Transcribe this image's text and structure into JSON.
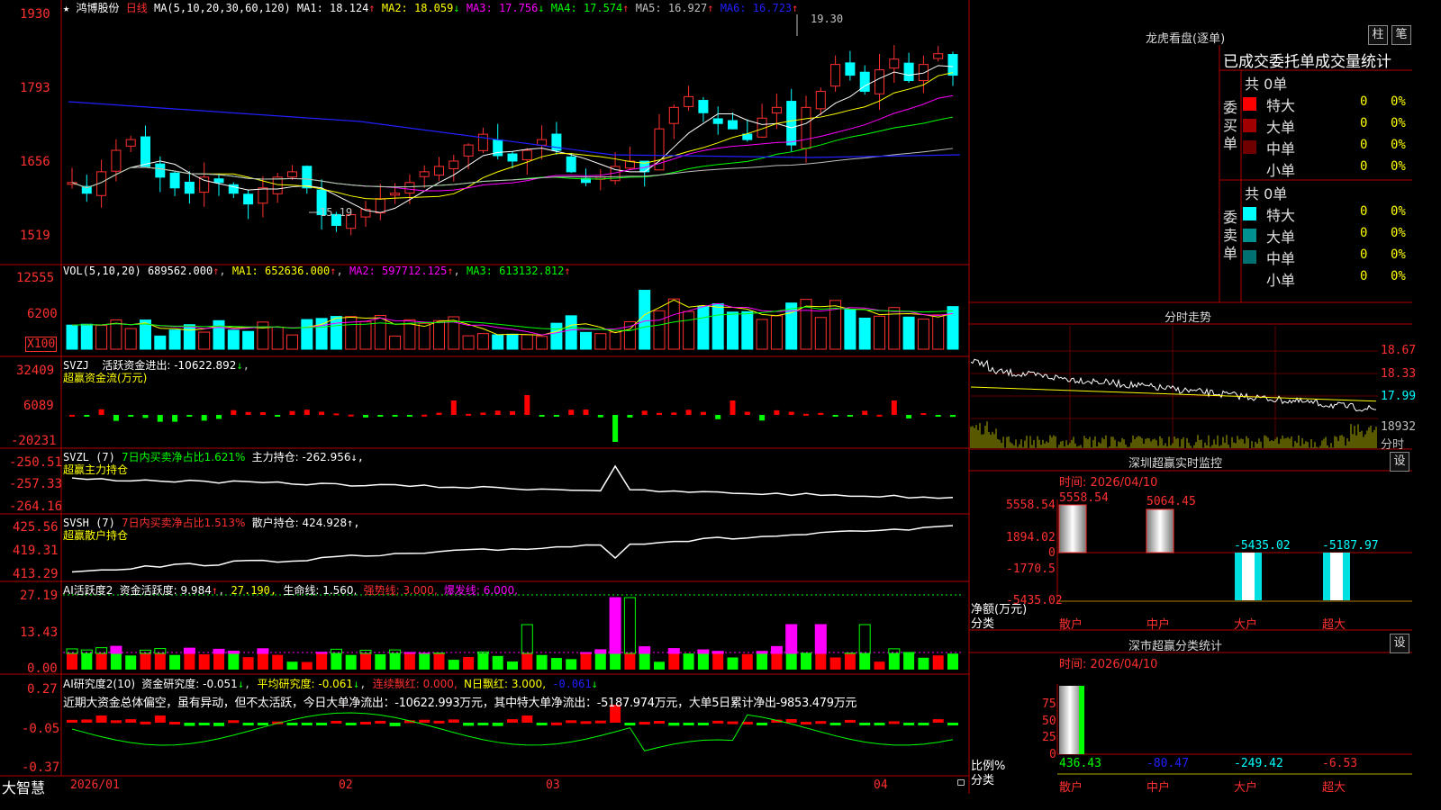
{
  "header": {
    "star": "★",
    "name": "鸿博股份",
    "period": "日线",
    "ma_prefix": "MA(5,10,20,30,60,120)",
    "mas": [
      {
        "label": "MA1: 18.124",
        "arrow": "↑",
        "color": "#ffffff"
      },
      {
        "label": "MA2: 18.059",
        "arrow": "↓",
        "color": "#ffff00"
      },
      {
        "label": "MA3: 17.756",
        "arrow": "↓",
        "color": "#ff00ff"
      },
      {
        "label": "MA4: 17.574",
        "arrow": "↑",
        "color": "#00ff00"
      },
      {
        "label": "MA5: 16.927",
        "arrow": "↑",
        "color": "#c0c0c0"
      },
      {
        "label": "MA6: 16.723",
        "arrow": "↑",
        "color": "#2020ff"
      }
    ]
  },
  "price_axis": [
    "1930",
    "1793",
    "1656",
    "1519"
  ],
  "price_annotations": {
    "high": "19.30",
    "low": "15.19"
  },
  "vol": {
    "title": "VOL(5,10,20)",
    "value": "689562.000",
    "ma1": "MA1: 652636.000",
    "ma2": "MA2: 597712.125",
    "ma3": "MA3: 613132.812",
    "axis": [
      "12555",
      "6200"
    ],
    "multiplier": "X100"
  },
  "svzj": {
    "title": "SVZJ",
    "label": "活跃资金进出: -10622.892",
    "arrow": "↓",
    "subtitle": "超赢资金流(万元)",
    "axis": [
      "32409",
      "6089",
      "-20231"
    ]
  },
  "svzl": {
    "title": "SVZL (7)",
    "label1": "7日内买卖净占比1.621%",
    "label2": "主力持仓: -262.956",
    "arrow": "↓,",
    "subtitle": "超赢主力持仓",
    "axis": [
      "-250.51",
      "-257.33",
      "-264.16"
    ]
  },
  "svsh": {
    "title": "SVSH (7)",
    "label1": "7日内买卖净占比1.513%",
    "label2": "散户持仓: 424.928",
    "arrow": "↑,",
    "subtitle": "超赢散户持仓",
    "axis": [
      "425.56",
      "419.31",
      "413.29"
    ]
  },
  "ai_active": {
    "title": "AI活跃度2",
    "label1": "资金活跃度: 9.984",
    "v2": "27.190,",
    "life": "生命线: 1.560,",
    "strong": "强势线: 3.000,",
    "burst": "爆发线: 6.000,",
    "axis": [
      "27.19",
      "13.43",
      "0.00"
    ]
  },
  "ai_research": {
    "title": "AI研究度2(10)",
    "label1": "资金研究度: -0.051",
    "avg": "平均研究度: -0.061",
    "red": "连续飘红: 0.000,",
    "nred": "N日飘红: 3.000,",
    "last": "-0.061",
    "summary": "近期大资金总体偏空，虽有异动，但不太活跃，今日大单净流出：-10622.993万元，其中特大单净流出：-5187.974万元，大单5日累计净出-9853.479万元",
    "axis": [
      "0.27",
      "-0.05",
      "-0.37"
    ]
  },
  "xaxis": {
    "brand": "大智慧",
    "labels": [
      "2026/01",
      "02",
      "03",
      "04"
    ]
  },
  "dragon": {
    "title": "龙虎看盘(逐单)",
    "btn1": "柱",
    "btn2": "笔",
    "tabs": "已成交委托单成交量统计",
    "buy_side": "委买单",
    "sell_side": "委卖单",
    "buy_total": "共 0单",
    "sell_total": "共 0单",
    "buy_rows": [
      {
        "name": "特大",
        "num": "0",
        "pct": "0%",
        "color": "#ff0000"
      },
      {
        "name": "大单",
        "num": "0",
        "pct": "0%",
        "color": "#a00000"
      },
      {
        "name": "中单",
        "num": "0",
        "pct": "0%",
        "color": "#700000"
      },
      {
        "name": "小单",
        "num": "0",
        "pct": "0%",
        "color": "#000000"
      }
    ],
    "sell_rows": [
      {
        "name": "特大",
        "num": "0",
        "pct": "0%",
        "color": "#00ffff"
      },
      {
        "name": "大单",
        "num": "0",
        "pct": "0%",
        "color": "#009090"
      },
      {
        "name": "中单",
        "num": "0",
        "pct": "0%",
        "color": "#007070"
      },
      {
        "name": "小单",
        "num": "0",
        "pct": "0%",
        "color": "#000000"
      }
    ]
  },
  "intraday": {
    "title": "分时走势",
    "axis": [
      "18.67",
      "18.33",
      "17.99"
    ],
    "vol_label": "18932",
    "vol_unit": "分时"
  },
  "sz_monitor": {
    "title": "深圳超赢实时监控",
    "set": "设",
    "time": "时间: 2026/04/10",
    "axis": [
      "5558.54",
      "1894.02",
      "0",
      "-1770.5",
      "-5435.02"
    ],
    "unit": "净额(万元)",
    "cat_label": "分类",
    "bars": [
      {
        "label": "散户",
        "value": "5558.54"
      },
      {
        "label": "中户",
        "value": "5064.45"
      },
      {
        "label": "大户",
        "value": "-5435.02"
      },
      {
        "label": "超大",
        "value": "-5187.97"
      }
    ]
  },
  "sz_class": {
    "title": "深市超赢分类统计",
    "set": "设",
    "time": "时间: 2026/04/10",
    "axis": [
      "75",
      "50",
      "25",
      "0"
    ],
    "unit": "比例%",
    "cat_label": "分类",
    "bars": [
      {
        "label": "散户",
        "value": "436.43"
      },
      {
        "label": "中户",
        "value": "-80.47"
      },
      {
        "label": "大户",
        "value": "-249.42"
      },
      {
        "label": "超大",
        "value": "-6.53"
      }
    ]
  },
  "colors": {
    "up": "#ff3030",
    "down": "#00ffff",
    "grid_red": "#b00000"
  }
}
